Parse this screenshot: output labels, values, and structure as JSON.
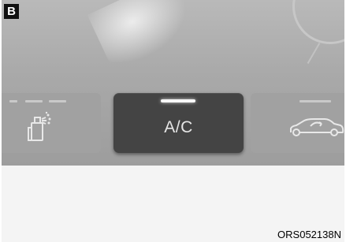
{
  "figure": {
    "badge": "B",
    "code": "ORS052138N"
  },
  "panel": {
    "center_button": {
      "label": "A/C",
      "indicator_on": true
    },
    "left_button": {
      "icon": "air-freshener-icon"
    },
    "right_button": {
      "icon": "car-recirculation-icon"
    }
  },
  "colors": {
    "panel_bg": "#a9a9a9",
    "button_dark": "#444444",
    "button_text": "#e6e6e6",
    "indicator": "#f7f7f7"
  }
}
